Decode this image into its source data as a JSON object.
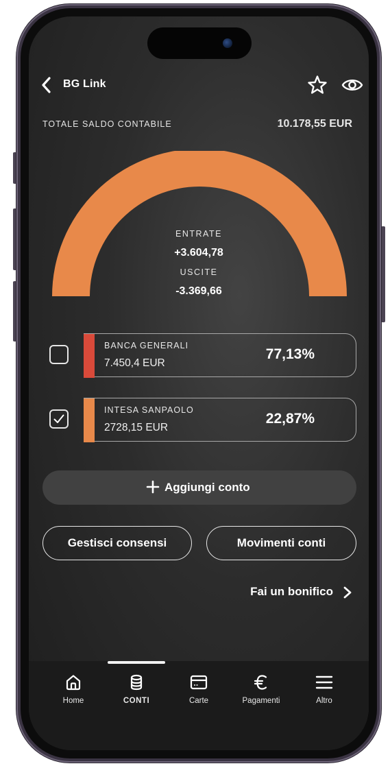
{
  "colors": {
    "accent_orange": "#E8894A",
    "bank1_strip": "#D94A3A",
    "bank2_strip": "#E8894A",
    "background": "#2A2A2A",
    "button_dark": "#414141"
  },
  "header": {
    "back_icon": "chevron-left-icon",
    "title": "BG Link",
    "star_icon": "star-icon",
    "eye_icon": "eye-icon"
  },
  "summary": {
    "label": "TOTALE SALDO CONTABILE",
    "value": "10.178,55 EUR"
  },
  "gauge": {
    "fill_fraction": 1.0,
    "entrate_label": "ENTRATE",
    "entrate_value": "+3.604,78",
    "uscite_label": "USCITE",
    "uscite_value": "-3.369,66"
  },
  "accounts": [
    {
      "name": "BANCA GENERALI",
      "amount": "7.450,4 EUR",
      "percent": "77,13%",
      "checked": false
    },
    {
      "name": "INTESA SANPAOLO",
      "amount": "2728,15 EUR",
      "percent": "22,87%",
      "checked": true
    }
  ],
  "actions": {
    "add_account": "Aggiungi conto",
    "manage_consents": "Gestisci consensi",
    "account_movements": "Movimenti conti",
    "transfer": "Fai un bonifico"
  },
  "tabbar": {
    "active": "CONTI",
    "items": [
      {
        "label": "Home",
        "icon": "home-icon"
      },
      {
        "label": "CONTI",
        "icon": "database-icon"
      },
      {
        "label": "Carte",
        "icon": "card-icon"
      },
      {
        "label": "Pagamenti",
        "icon": "euro-icon"
      },
      {
        "label": "Altro",
        "icon": "menu-icon"
      }
    ]
  }
}
